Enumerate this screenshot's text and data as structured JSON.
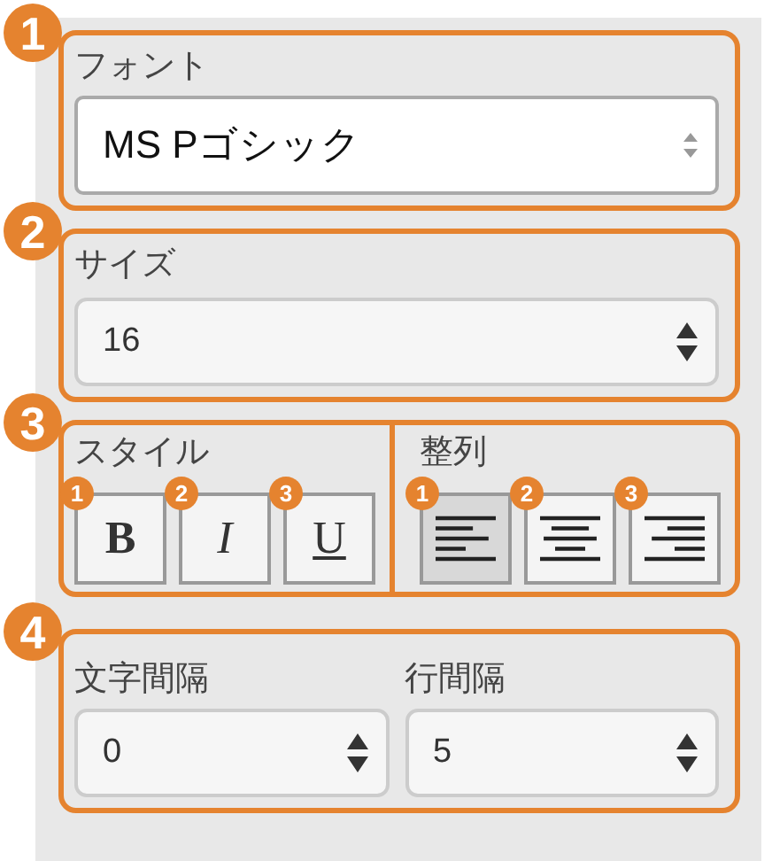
{
  "font": {
    "badge": "1",
    "label": "フォント",
    "value": "MS Pゴシック"
  },
  "size": {
    "badge": "2",
    "label": "サイズ",
    "value": "16"
  },
  "format": {
    "badge": "3",
    "style": {
      "label": "スタイル",
      "buttons": [
        {
          "badge": "1",
          "kind": "bold",
          "text": "B",
          "selected": false
        },
        {
          "badge": "2",
          "kind": "italic",
          "text": "I",
          "selected": false
        },
        {
          "badge": "3",
          "kind": "underline",
          "text": "U",
          "selected": false
        }
      ]
    },
    "align": {
      "label": "整列",
      "buttons": [
        {
          "badge": "1",
          "kind": "left",
          "selected": true
        },
        {
          "badge": "2",
          "kind": "center",
          "selected": false
        },
        {
          "badge": "3",
          "kind": "right",
          "selected": false
        }
      ]
    }
  },
  "spacing": {
    "badge": "4",
    "fields": [
      {
        "label": "文字間隔",
        "value": "0"
      },
      {
        "label": "行間隔",
        "value": "5"
      }
    ]
  }
}
